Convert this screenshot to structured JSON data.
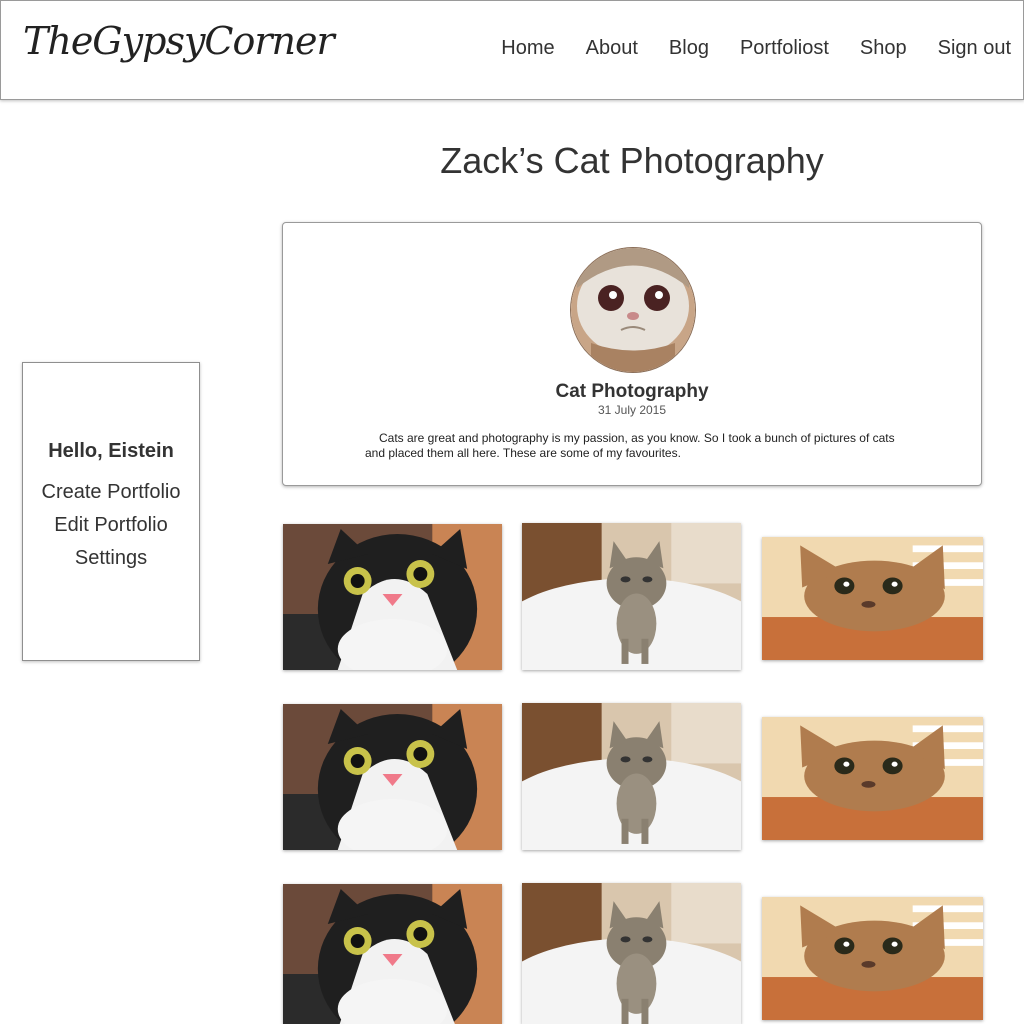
{
  "header": {
    "logo": "TheGypsyCorner",
    "nav": [
      "Home",
      "About",
      "Blog",
      "Portfoliost",
      "Shop",
      "Sign out"
    ]
  },
  "page": {
    "title": "Zack’s Cat Photography"
  },
  "sidebar": {
    "greeting": "Hello, Eistein",
    "links": [
      "Create Portfolio",
      "Edit Portfolio",
      "Settings"
    ]
  },
  "portfolio": {
    "title": "Cat Photography",
    "date": "31 July 2015",
    "description": "Cats are great and photography is my passion, as you know. So I took a bunch of pictures of cats and placed them all here. These are some of my favourites."
  },
  "colors": {
    "text": "#333333",
    "border": "#9a9a9a",
    "background": "#ffffff"
  }
}
